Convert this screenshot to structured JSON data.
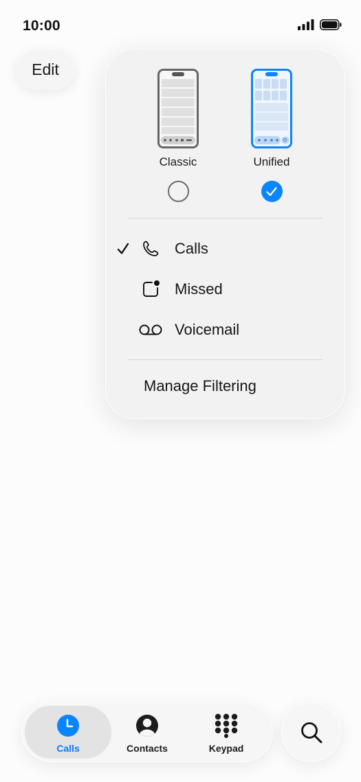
{
  "status_bar": {
    "time": "10:00"
  },
  "toolbar": {
    "edit_label": "Edit"
  },
  "layout_options": [
    {
      "label": "Classic",
      "selected": false
    },
    {
      "label": "Unified",
      "selected": true
    }
  ],
  "filter_menu": {
    "items": [
      {
        "label": "Calls",
        "icon": "phone-icon",
        "checked": true
      },
      {
        "label": "Missed",
        "icon": "missed-badge-icon",
        "checked": false
      },
      {
        "label": "Voicemail",
        "icon": "voicemail-icon",
        "checked": false
      }
    ],
    "manage_label": "Manage Filtering"
  },
  "tab_bar": {
    "tabs": [
      {
        "label": "Calls",
        "icon": "clock-icon",
        "active": true
      },
      {
        "label": "Contacts",
        "icon": "person-icon",
        "active": false
      },
      {
        "label": "Keypad",
        "icon": "keypad-icon",
        "active": false
      }
    ],
    "search_icon": "search-icon"
  },
  "colors": {
    "accent": "#0a84ff",
    "active_tab_label": "#0a7aff"
  }
}
